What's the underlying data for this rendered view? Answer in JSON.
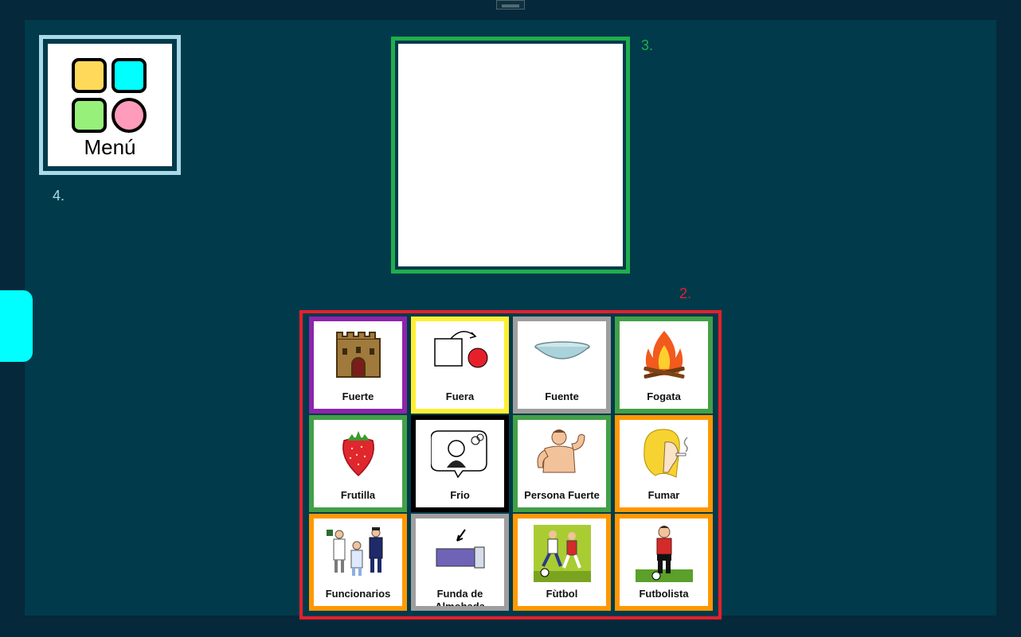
{
  "menu": {
    "label": "Menú",
    "annotation": "4."
  },
  "display": {
    "annotation": "3."
  },
  "board": {
    "annotation": "2.",
    "tiles": [
      {
        "label": "Fuerte",
        "color": "#8e24aa",
        "icon": "castle-icon"
      },
      {
        "label": "Fuera",
        "color": "#ffee33",
        "icon": "out-icon"
      },
      {
        "label": "Fuente",
        "color": "#9e9e9e",
        "icon": "bowl-icon"
      },
      {
        "label": "Fogata",
        "color": "#43a047",
        "icon": "campfire-icon"
      },
      {
        "label": "Frutilla",
        "color": "#43a047",
        "icon": "strawberry-icon"
      },
      {
        "label": "Frio",
        "color": "#000000",
        "icon": "cold-person-icon"
      },
      {
        "label": "Persona Fuerte",
        "color": "#43a047",
        "icon": "strong-person-icon"
      },
      {
        "label": "Fumar",
        "color": "#ff9800",
        "icon": "smoking-icon"
      },
      {
        "label": "Funcionarios",
        "color": "#ff9800",
        "icon": "officials-icon"
      },
      {
        "label": "Funda de Almohada",
        "color": "#9e9e9e",
        "icon": "pillowcase-icon"
      },
      {
        "label": "Fùtbol",
        "color": "#ff9800",
        "icon": "soccer-icon"
      },
      {
        "label": "Futbolista",
        "color": "#ff9800",
        "icon": "soccer-player-icon"
      }
    ]
  }
}
